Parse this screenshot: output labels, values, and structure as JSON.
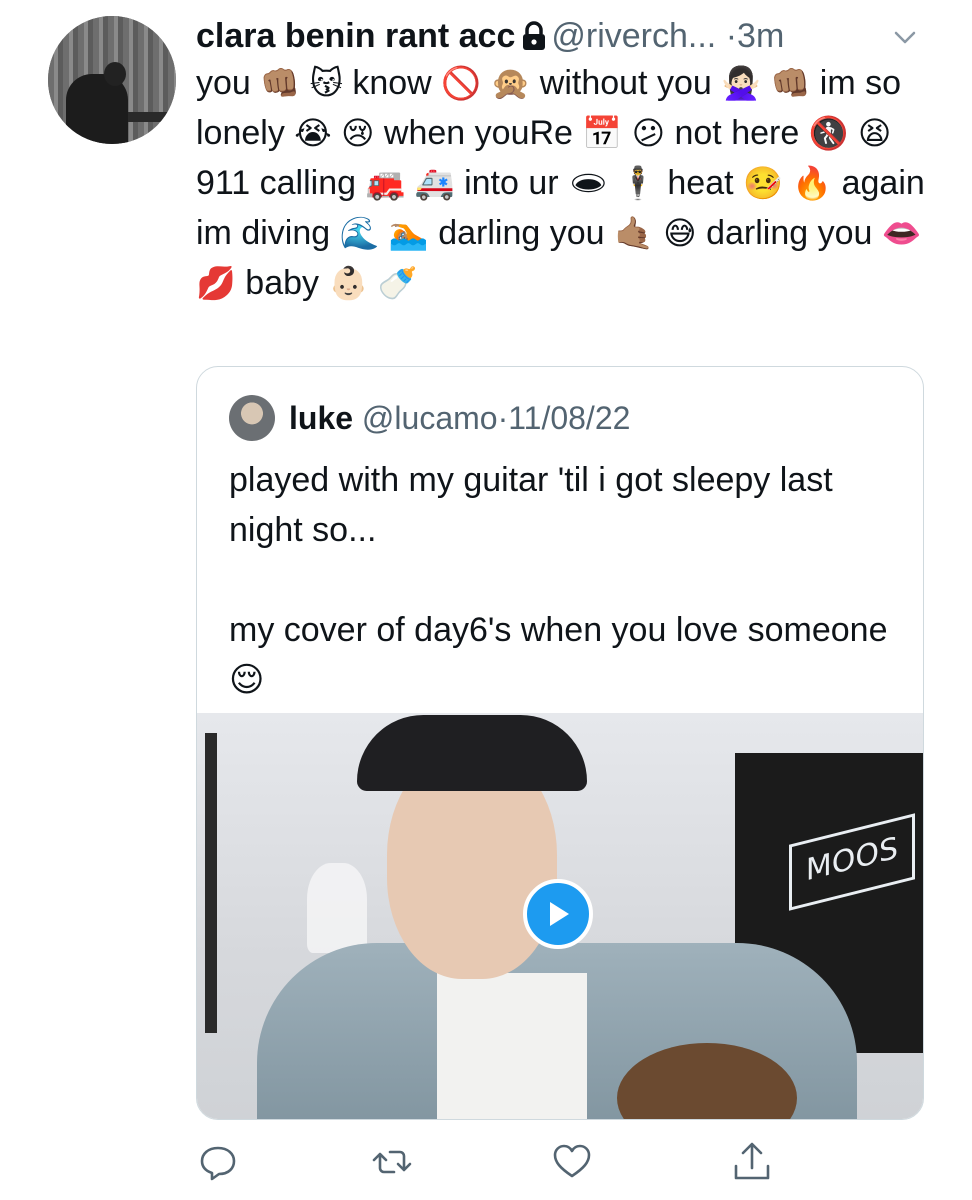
{
  "tweet": {
    "display_name": "clara benin rant acc",
    "handle": "@riverch...",
    "separator": "·",
    "time": "3m",
    "text": [
      {
        "t": "you "
      },
      {
        "e": "👊🏽"
      },
      {
        "t": " "
      },
      {
        "e": "😽"
      },
      {
        "t": " know "
      },
      {
        "e": "🚫"
      },
      {
        "t": " "
      },
      {
        "e": "🙊"
      },
      {
        "t": " without you "
      },
      {
        "e": "🙅🏻‍♀️"
      },
      {
        "t": " "
      },
      {
        "e": "👊🏽"
      },
      {
        "t": " im so lonely "
      },
      {
        "e": "😭"
      },
      {
        "t": " "
      },
      {
        "e": "😢"
      },
      {
        "t": " when youRe "
      },
      {
        "e": "📅"
      },
      {
        "t": " "
      },
      {
        "e": "😕"
      },
      {
        "t": " not here "
      },
      {
        "e": "🚷"
      },
      {
        "t": " "
      },
      {
        "e": "😫"
      },
      {
        "t": " 911 calling "
      },
      {
        "e": "🚒"
      },
      {
        "t": " "
      },
      {
        "e": "🚑"
      },
      {
        "t": " into ur "
      },
      {
        "e": "🕳"
      },
      {
        "t": " "
      },
      {
        "e": "🕴"
      },
      {
        "t": " heat "
      },
      {
        "e": "🤒"
      },
      {
        "t": " "
      },
      {
        "e": "🔥"
      },
      {
        "t": " again im diving "
      },
      {
        "e": "🌊"
      },
      {
        "t": " "
      },
      {
        "e": "🏊🏽"
      },
      {
        "t": " darling you "
      },
      {
        "e": "🤙🏽"
      },
      {
        "t": " "
      },
      {
        "e": "😅"
      },
      {
        "t": " darling you "
      },
      {
        "e": "👄"
      },
      {
        "t": " "
      },
      {
        "e": "💋"
      },
      {
        "t": " baby "
      },
      {
        "e": "👶🏻"
      },
      {
        "t": " "
      },
      {
        "e": "🍼"
      }
    ]
  },
  "quote": {
    "display_name": "luke",
    "handle": "@lucamo",
    "separator": "·",
    "date": "11/08/22",
    "line1": "played with my guitar 'til i got sleepy last night so...",
    "line2": "my cover of day6's when you love someone",
    "line2_emoji": "😌",
    "neon_sign": "MOOS"
  },
  "icons": {
    "lock": "lock-icon",
    "caret": "chevron-down-icon",
    "play": "play-icon",
    "reply": "reply-icon",
    "retweet": "retweet-icon",
    "like": "heart-icon",
    "share": "share-icon"
  },
  "colors": {
    "accent": "#1d9bf0",
    "secondary_text": "#536471",
    "border": "#cfd9de"
  }
}
